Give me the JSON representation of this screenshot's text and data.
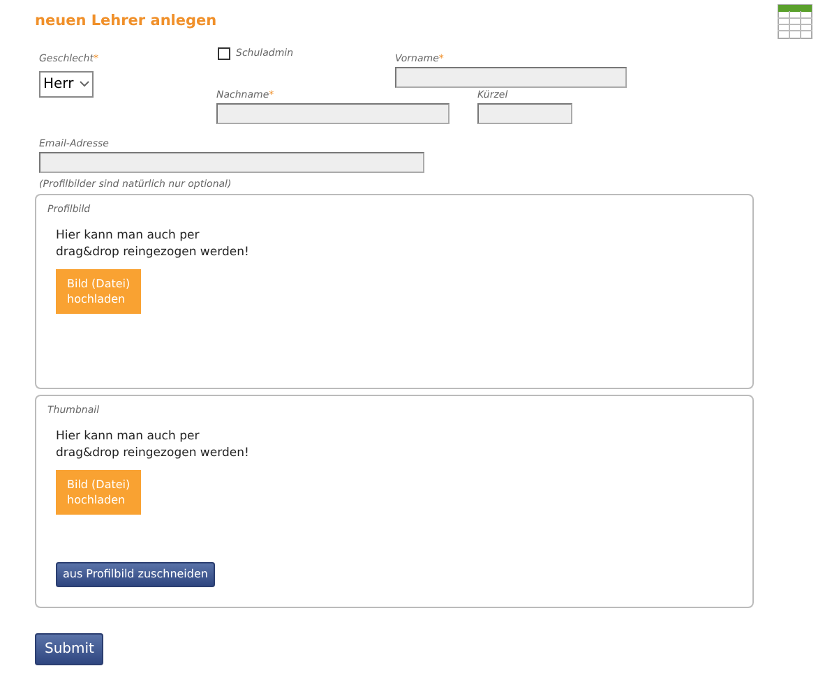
{
  "title": "neuen Lehrer anlegen",
  "fields": [
    {
      "kind": "select",
      "label": "Geschlecht",
      "required_mark": "*",
      "value": "Herr"
    },
    {
      "kind": "checkbox",
      "label": "Schuladmin",
      "checked": false
    },
    {
      "kind": "text",
      "label": "Vorname",
      "required_mark": "*"
    },
    {
      "kind": "text",
      "label": "Nachname",
      "required_mark": "*"
    },
    {
      "kind": "text",
      "label": "Kürzel"
    },
    {
      "kind": "text",
      "label": "Email-Adresse"
    }
  ],
  "note": "(Profilbilder sind natürlich nur optional)",
  "panels": [
    {
      "title": "Profilbild",
      "hint_lines": [
        "Hier kann man auch per",
        "drag&drop reingezogen werden!"
      ],
      "upload_lines": [
        "Bild (Datei)",
        "hochladen"
      ]
    },
    {
      "title": "Thumbnail",
      "hint_lines": [
        "Hier kann man auch per",
        "drag&drop reingezogen werden!"
      ],
      "upload_lines": [
        "Bild (Datei)",
        "hochladen"
      ],
      "crop_button": "aus Profilbild zuschneiden"
    }
  ],
  "submit": "Submit"
}
